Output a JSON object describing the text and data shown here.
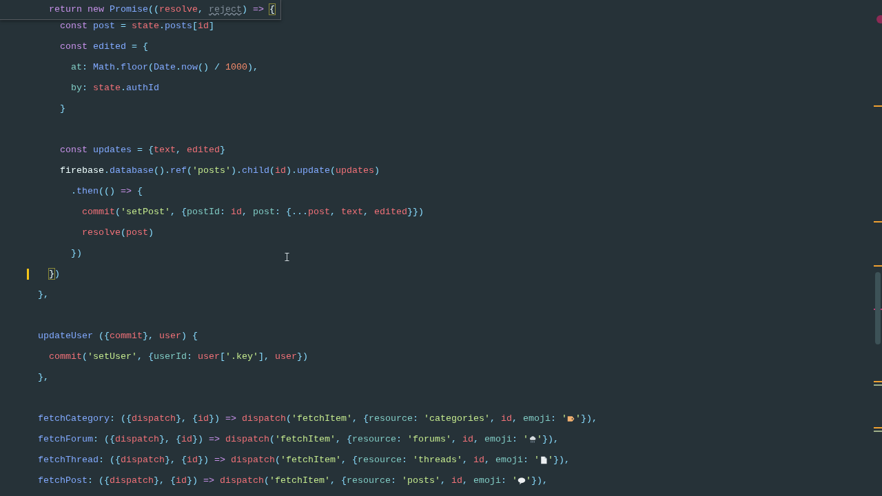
{
  "sticky_header": {
    "tokens": [
      {
        "kind": "kw",
        "text": "  return new "
      },
      {
        "kind": "fn",
        "text": "Promise"
      },
      {
        "kind": "op",
        "text": "(("
      },
      {
        "kind": "var",
        "text": "resolve"
      },
      {
        "kind": "op",
        "text": ", "
      },
      {
        "kind": "unused",
        "text": "reject"
      },
      {
        "kind": "op",
        "text": ") "
      },
      {
        "kind": "kw",
        "text": "=> "
      },
      {
        "kind": "match",
        "text": "{"
      }
    ]
  },
  "lines": [
    {
      "modified": false,
      "tokens": [
        {
          "kind": "kw",
          "text": "    const "
        },
        {
          "kind": "fn",
          "text": "post"
        },
        {
          "kind": "op",
          "text": " = "
        },
        {
          "kind": "var",
          "text": "state"
        },
        {
          "kind": "op",
          "text": "."
        },
        {
          "kind": "fn",
          "text": "posts"
        },
        {
          "kind": "op",
          "text": "["
        },
        {
          "kind": "var",
          "text": "id"
        },
        {
          "kind": "op",
          "text": "]"
        }
      ]
    },
    {
      "modified": false,
      "tokens": [
        {
          "kind": "kw",
          "text": "    const "
        },
        {
          "kind": "fn",
          "text": "edited"
        },
        {
          "kind": "op",
          "text": " = {"
        }
      ]
    },
    {
      "modified": false,
      "tokens": [
        {
          "kind": "prop",
          "text": "      at"
        },
        {
          "kind": "op",
          "text": ": "
        },
        {
          "kind": "fn",
          "text": "Math"
        },
        {
          "kind": "op",
          "text": "."
        },
        {
          "kind": "fn",
          "text": "floor"
        },
        {
          "kind": "op",
          "text": "("
        },
        {
          "kind": "fn",
          "text": "Date"
        },
        {
          "kind": "op",
          "text": "."
        },
        {
          "kind": "fn",
          "text": "now"
        },
        {
          "kind": "op",
          "text": "() / "
        },
        {
          "kind": "num",
          "text": "1000"
        },
        {
          "kind": "op",
          "text": "),"
        }
      ]
    },
    {
      "modified": false,
      "tokens": [
        {
          "kind": "prop",
          "text": "      by"
        },
        {
          "kind": "op",
          "text": ": "
        },
        {
          "kind": "var",
          "text": "state"
        },
        {
          "kind": "op",
          "text": "."
        },
        {
          "kind": "fn",
          "text": "authId"
        }
      ]
    },
    {
      "modified": false,
      "tokens": [
        {
          "kind": "op",
          "text": "    }"
        }
      ]
    },
    {
      "modified": false
    },
    {
      "modified": false,
      "tokens": [
        {
          "kind": "kw",
          "text": "    const "
        },
        {
          "kind": "fn",
          "text": "updates"
        },
        {
          "kind": "op",
          "text": " = {"
        },
        {
          "kind": "var",
          "text": "text"
        },
        {
          "kind": "op",
          "text": ", "
        },
        {
          "kind": "var",
          "text": "edited"
        },
        {
          "kind": "op",
          "text": "}"
        }
      ]
    },
    {
      "modified": false,
      "tokens": [
        {
          "kind": "plain",
          "text": "    firebase"
        },
        {
          "kind": "op",
          "text": "."
        },
        {
          "kind": "fn",
          "text": "database"
        },
        {
          "kind": "op",
          "text": "()."
        },
        {
          "kind": "fn",
          "text": "ref"
        },
        {
          "kind": "op",
          "text": "("
        },
        {
          "kind": "str",
          "text": "'posts'"
        },
        {
          "kind": "op",
          "text": ")."
        },
        {
          "kind": "fn",
          "text": "child"
        },
        {
          "kind": "op",
          "text": "("
        },
        {
          "kind": "var",
          "text": "id"
        },
        {
          "kind": "op",
          "text": ")."
        },
        {
          "kind": "fn",
          "text": "update"
        },
        {
          "kind": "op",
          "text": "("
        },
        {
          "kind": "var",
          "text": "updates"
        },
        {
          "kind": "op",
          "text": ")"
        }
      ]
    },
    {
      "modified": false,
      "tokens": [
        {
          "kind": "op",
          "text": "      ."
        },
        {
          "kind": "fn",
          "text": "then"
        },
        {
          "kind": "op",
          "text": "(() "
        },
        {
          "kind": "kw",
          "text": "=>"
        },
        {
          "kind": "op",
          "text": " {"
        }
      ]
    },
    {
      "modified": false,
      "tokens": [
        {
          "kind": "var",
          "text": "        commit"
        },
        {
          "kind": "op",
          "text": "("
        },
        {
          "kind": "str",
          "text": "'setPost'"
        },
        {
          "kind": "op",
          "text": ", {"
        },
        {
          "kind": "prop",
          "text": "postId"
        },
        {
          "kind": "op",
          "text": ": "
        },
        {
          "kind": "var",
          "text": "id"
        },
        {
          "kind": "op",
          "text": ", "
        },
        {
          "kind": "prop",
          "text": "post"
        },
        {
          "kind": "op",
          "text": ": {..."
        },
        {
          "kind": "var",
          "text": "post"
        },
        {
          "kind": "op",
          "text": ", "
        },
        {
          "kind": "var",
          "text": "text"
        },
        {
          "kind": "op",
          "text": ", "
        },
        {
          "kind": "var",
          "text": "edited"
        },
        {
          "kind": "op",
          "text": "}})"
        }
      ]
    },
    {
      "modified": false,
      "tokens": [
        {
          "kind": "var",
          "text": "        resolve"
        },
        {
          "kind": "op",
          "text": "("
        },
        {
          "kind": "var",
          "text": "post"
        },
        {
          "kind": "op",
          "text": ")"
        }
      ]
    },
    {
      "modified": false,
      "tokens": [
        {
          "kind": "op",
          "text": "      })"
        }
      ]
    },
    {
      "modified": true,
      "tokens": [
        {
          "kind": "match",
          "text": "  }"
        },
        {
          "kind": "op",
          "text": ")"
        }
      ]
    },
    {
      "modified": false,
      "tokens": [
        {
          "kind": "op",
          "text": "},"
        }
      ]
    },
    {
      "modified": false
    },
    {
      "modified": false,
      "tokens": [
        {
          "kind": "fn",
          "text": "updateUser"
        },
        {
          "kind": "op",
          "text": " ({"
        },
        {
          "kind": "var",
          "text": "commit"
        },
        {
          "kind": "op",
          "text": "}, "
        },
        {
          "kind": "var",
          "text": "user"
        },
        {
          "kind": "op",
          "text": ") {"
        }
      ]
    },
    {
      "modified": false,
      "tokens": [
        {
          "kind": "var",
          "text": "  commit"
        },
        {
          "kind": "op",
          "text": "("
        },
        {
          "kind": "str",
          "text": "'setUser'"
        },
        {
          "kind": "op",
          "text": ", {"
        },
        {
          "kind": "prop",
          "text": "userId"
        },
        {
          "kind": "op",
          "text": ": "
        },
        {
          "kind": "var",
          "text": "user"
        },
        {
          "kind": "op",
          "text": "["
        },
        {
          "kind": "str",
          "text": "'.key'"
        },
        {
          "kind": "op",
          "text": "], "
        },
        {
          "kind": "var",
          "text": "user"
        },
        {
          "kind": "op",
          "text": "})"
        }
      ]
    },
    {
      "modified": false,
      "tokens": [
        {
          "kind": "op",
          "text": "},"
        }
      ]
    },
    {
      "modified": false
    },
    {
      "modified": false,
      "tokens": [
        {
          "kind": "fn",
          "text": "fetchCategory"
        },
        {
          "kind": "op",
          "text": ": ({"
        },
        {
          "kind": "var",
          "text": "dispatch"
        },
        {
          "kind": "op",
          "text": "}, {"
        },
        {
          "kind": "var",
          "text": "id"
        },
        {
          "kind": "op",
          "text": "}) "
        },
        {
          "kind": "kw",
          "text": "=> "
        },
        {
          "kind": "var",
          "text": "dispatch"
        },
        {
          "kind": "op",
          "text": "("
        },
        {
          "kind": "str",
          "text": "'fetchItem'"
        },
        {
          "kind": "op",
          "text": ", {"
        },
        {
          "kind": "prop",
          "text": "resource"
        },
        {
          "kind": "op",
          "text": ": "
        },
        {
          "kind": "str",
          "text": "'categories'"
        },
        {
          "kind": "op",
          "text": ", "
        },
        {
          "kind": "var",
          "text": "id"
        },
        {
          "kind": "op",
          "text": ", "
        },
        {
          "kind": "prop",
          "text": "emoji"
        },
        {
          "kind": "op",
          "text": ": "
        },
        {
          "kind": "str",
          "text": "'"
        },
        {
          "kind": "emoji"
        },
        {
          "kind": "str",
          "text": "'"
        },
        {
          "kind": "op",
          "text": "}),"
        }
      ]
    },
    {
      "modified": false,
      "tokens": [
        {
          "kind": "fn",
          "text": "fetchForum"
        },
        {
          "kind": "op",
          "text": ": ({"
        },
        {
          "kind": "var",
          "text": "dispatch"
        },
        {
          "kind": "op",
          "text": "}, {"
        },
        {
          "kind": "var",
          "text": "id"
        },
        {
          "kind": "op",
          "text": "}) "
        },
        {
          "kind": "kw",
          "text": "=> "
        },
        {
          "kind": "var",
          "text": "dispatch"
        },
        {
          "kind": "op",
          "text": "("
        },
        {
          "kind": "str",
          "text": "'fetchItem'"
        },
        {
          "kind": "op",
          "text": ", {"
        },
        {
          "kind": "prop",
          "text": "resource"
        },
        {
          "kind": "op",
          "text": ": "
        },
        {
          "kind": "str",
          "text": "'forums'"
        },
        {
          "kind": "op",
          "text": ", "
        },
        {
          "kind": "var",
          "text": "id"
        },
        {
          "kind": "op",
          "text": ", "
        },
        {
          "kind": "prop",
          "text": "emoji"
        },
        {
          "kind": "op",
          "text": ": "
        },
        {
          "kind": "str",
          "text": "'"
        },
        {
          "kind": "emoji"
        },
        {
          "kind": "str",
          "text": "'"
        },
        {
          "kind": "op",
          "text": "}),"
        }
      ]
    },
    {
      "modified": false,
      "tokens": [
        {
          "kind": "fn",
          "text": "fetchThread"
        },
        {
          "kind": "op",
          "text": ": ({"
        },
        {
          "kind": "var",
          "text": "dispatch"
        },
        {
          "kind": "op",
          "text": "}, {"
        },
        {
          "kind": "var",
          "text": "id"
        },
        {
          "kind": "op",
          "text": "}) "
        },
        {
          "kind": "kw",
          "text": "=> "
        },
        {
          "kind": "var",
          "text": "dispatch"
        },
        {
          "kind": "op",
          "text": "("
        },
        {
          "kind": "str",
          "text": "'fetchItem'"
        },
        {
          "kind": "op",
          "text": ", {"
        },
        {
          "kind": "prop",
          "text": "resource"
        },
        {
          "kind": "op",
          "text": ": "
        },
        {
          "kind": "str",
          "text": "'threads'"
        },
        {
          "kind": "op",
          "text": ", "
        },
        {
          "kind": "var",
          "text": "id"
        },
        {
          "kind": "op",
          "text": ", "
        },
        {
          "kind": "prop",
          "text": "emoji"
        },
        {
          "kind": "op",
          "text": ": "
        },
        {
          "kind": "str",
          "text": "'"
        },
        {
          "kind": "emoji"
        },
        {
          "kind": "str",
          "text": "'"
        },
        {
          "kind": "op",
          "text": "}),"
        }
      ]
    },
    {
      "modified": false,
      "tokens": [
        {
          "kind": "fn",
          "text": "fetchPost"
        },
        {
          "kind": "op",
          "text": ": ({"
        },
        {
          "kind": "var",
          "text": "dispatch"
        },
        {
          "kind": "op",
          "text": "}, {"
        },
        {
          "kind": "var",
          "text": "id"
        },
        {
          "kind": "op",
          "text": "}) "
        },
        {
          "kind": "kw",
          "text": "=> "
        },
        {
          "kind": "var",
          "text": "dispatch"
        },
        {
          "kind": "op",
          "text": "("
        },
        {
          "kind": "str",
          "text": "'fetchItem'"
        },
        {
          "kind": "op",
          "text": ", {"
        },
        {
          "kind": "prop",
          "text": "resource"
        },
        {
          "kind": "op",
          "text": ": "
        },
        {
          "kind": "str",
          "text": "'posts'"
        },
        {
          "kind": "op",
          "text": ", "
        },
        {
          "kind": "var",
          "text": "id"
        },
        {
          "kind": "op",
          "text": ", "
        },
        {
          "kind": "prop",
          "text": "emoji"
        },
        {
          "kind": "op",
          "text": ": "
        },
        {
          "kind": "str",
          "text": "'"
        },
        {
          "kind": "emoji"
        },
        {
          "kind": "str",
          "text": "'"
        },
        {
          "kind": "op",
          "text": "}),"
        }
      ]
    }
  ]
}
